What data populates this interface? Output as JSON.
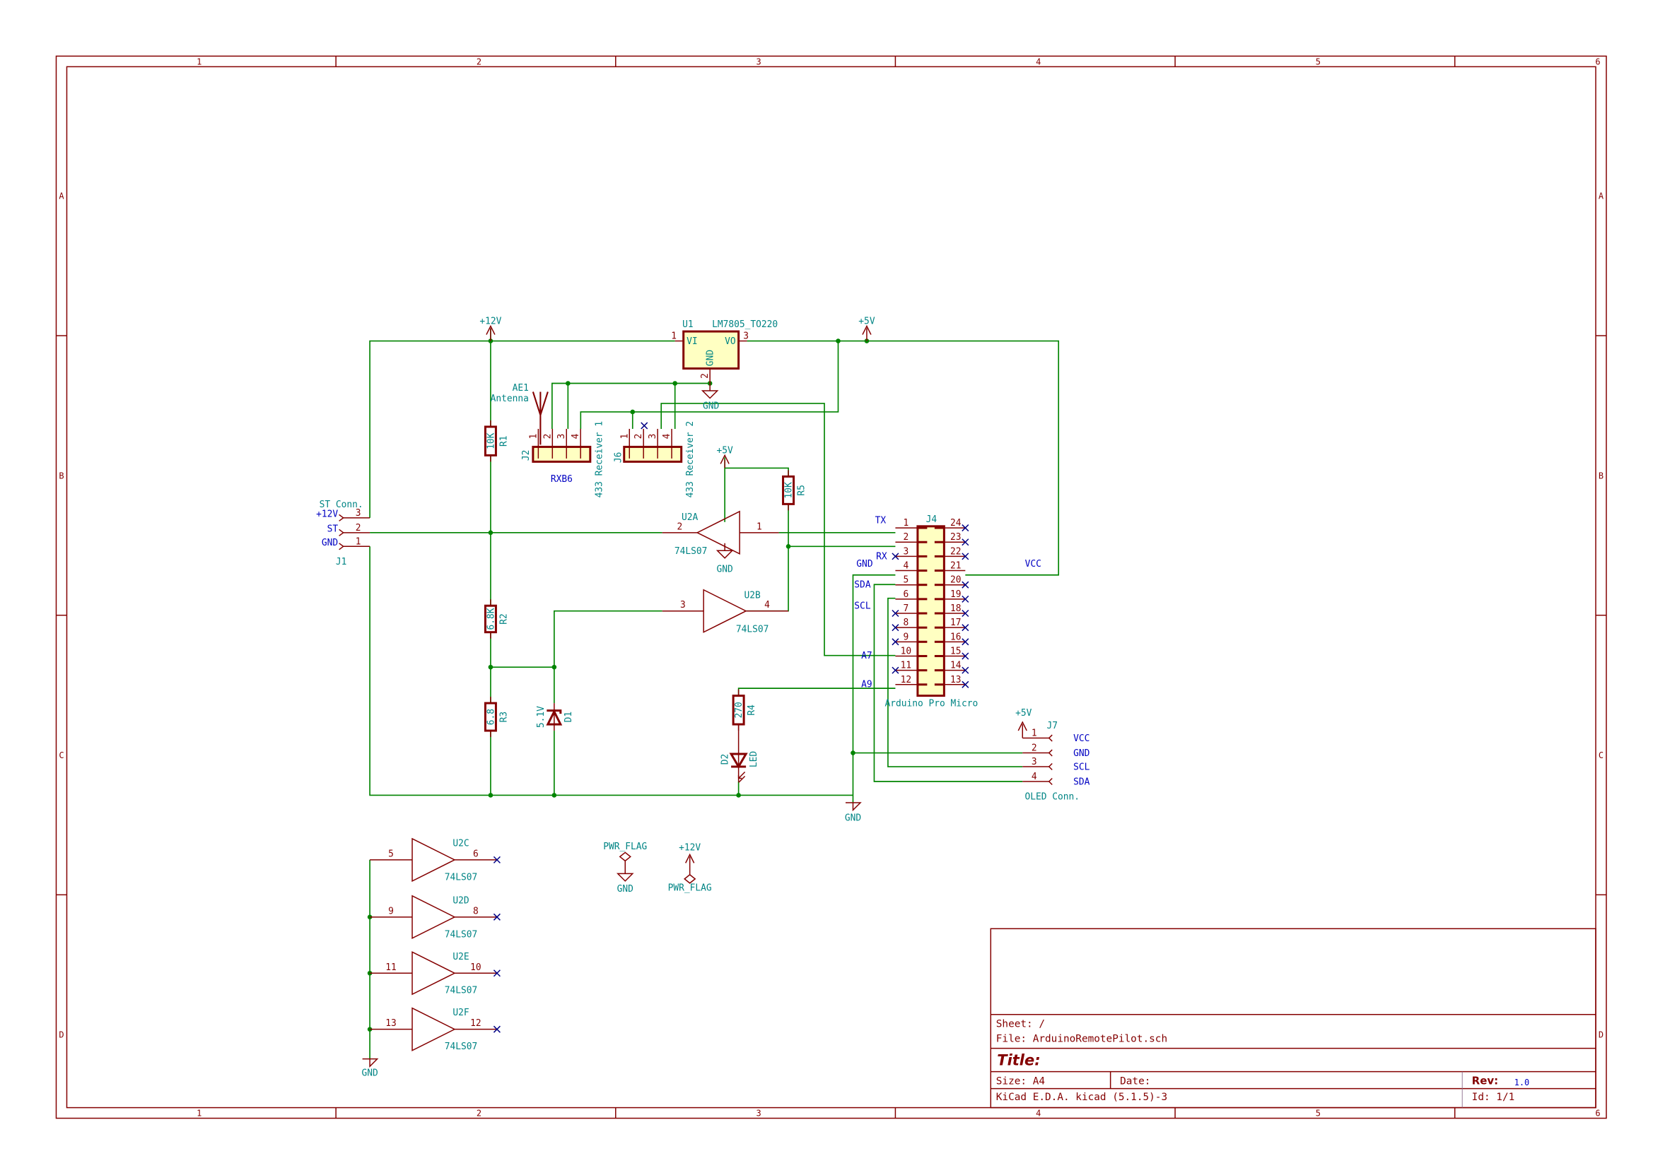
{
  "colors": {
    "wire": "#008400",
    "component": "#840000",
    "text": "#008484",
    "label": "#0000c2",
    "body_fill": "#ffffc2",
    "no_connect": "#000084",
    "frame": "#840000"
  },
  "frame": {
    "col_labels": [
      "1",
      "2",
      "3",
      "4",
      "5",
      "6"
    ],
    "row_labels": [
      "A",
      "B",
      "C",
      "D"
    ]
  },
  "title_block": {
    "sheet": "Sheet: /",
    "file": "File: ArduinoRemotePilot.sch",
    "title": "Title:",
    "size": "Size: A4",
    "date": "Date:",
    "rev_label": "Rev:",
    "rev": "1.0",
    "tool": "KiCad E.D.A.  kicad (5.1.5)-3",
    "id": "Id: 1/1"
  },
  "power": {
    "p12v": "+12V",
    "p5v": "+5V",
    "gnd": "GND",
    "pwr_flag": "PWR_FLAG"
  },
  "u1": {
    "ref": "U1",
    "value": "LM7805_TO220",
    "vi": "VI",
    "vo": "VO",
    "gnd": "GND",
    "pins": [
      "1",
      "2",
      "3"
    ]
  },
  "ae1": {
    "ref": "AE1",
    "value": "Antenna"
  },
  "j2": {
    "ref": "J2",
    "value": "433 Receiver 1",
    "note": "RXB6",
    "pins": [
      "1",
      "2",
      "3",
      "4"
    ]
  },
  "j6": {
    "ref": "J6",
    "value": "433 Receiver 2",
    "pins": [
      "1",
      "2",
      "3",
      "4"
    ]
  },
  "j1": {
    "ref": "J1",
    "value": "ST Conn.",
    "pins": [
      "3",
      "2",
      "1"
    ],
    "labels": [
      "+12V",
      "ST",
      "GND"
    ]
  },
  "resistors": [
    {
      "ref": "R1",
      "value": "10K"
    },
    {
      "ref": "R2",
      "value": "6.8K"
    },
    {
      "ref": "R3",
      "value": "6.8"
    },
    {
      "ref": "R4",
      "value": "270"
    },
    {
      "ref": "R5",
      "value": "10K"
    }
  ],
  "d1": {
    "ref": "D1",
    "value": "5.1V"
  },
  "d2": {
    "ref": "D2",
    "value": "LED"
  },
  "gates": [
    {
      "ref": "U2A",
      "value": "74LS07",
      "in": "2",
      "out": "1"
    },
    {
      "ref": "U2B",
      "value": "74LS07",
      "in": "3",
      "out": "4"
    },
    {
      "ref": "U2C",
      "value": "74LS07",
      "in": "5",
      "out": "6"
    },
    {
      "ref": "U2D",
      "value": "74LS07",
      "in": "9",
      "out": "8"
    },
    {
      "ref": "U2E",
      "value": "74LS07",
      "in": "11",
      "out": "10"
    },
    {
      "ref": "U2F",
      "value": "74LS07",
      "in": "13",
      "out": "12"
    }
  ],
  "j4": {
    "ref": "J4",
    "value": "Arduino Pro Micro",
    "left_pins": [
      "1",
      "2",
      "3",
      "4",
      "5",
      "6",
      "7",
      "8",
      "9",
      "10",
      "11",
      "12"
    ],
    "right_pins": [
      "24",
      "23",
      "22",
      "21",
      "20",
      "19",
      "18",
      "17",
      "16",
      "15",
      "14",
      "13"
    ],
    "left_nc": [
      "3",
      "7",
      "8",
      "9",
      "11"
    ],
    "right_connected": [
      "21"
    ],
    "net_labels": {
      "tx": "TX",
      "rx": "RX",
      "gnd": "GND",
      "sda": "SDA",
      "scl": "SCL",
      "a7": "A7",
      "a9": "A9",
      "vcc": "VCC"
    }
  },
  "j7": {
    "ref": "J7",
    "value": "OLED Conn.",
    "pins": [
      "1",
      "2",
      "3",
      "4"
    ],
    "labels": [
      "VCC",
      "GND",
      "SCL",
      "SDA"
    ]
  }
}
